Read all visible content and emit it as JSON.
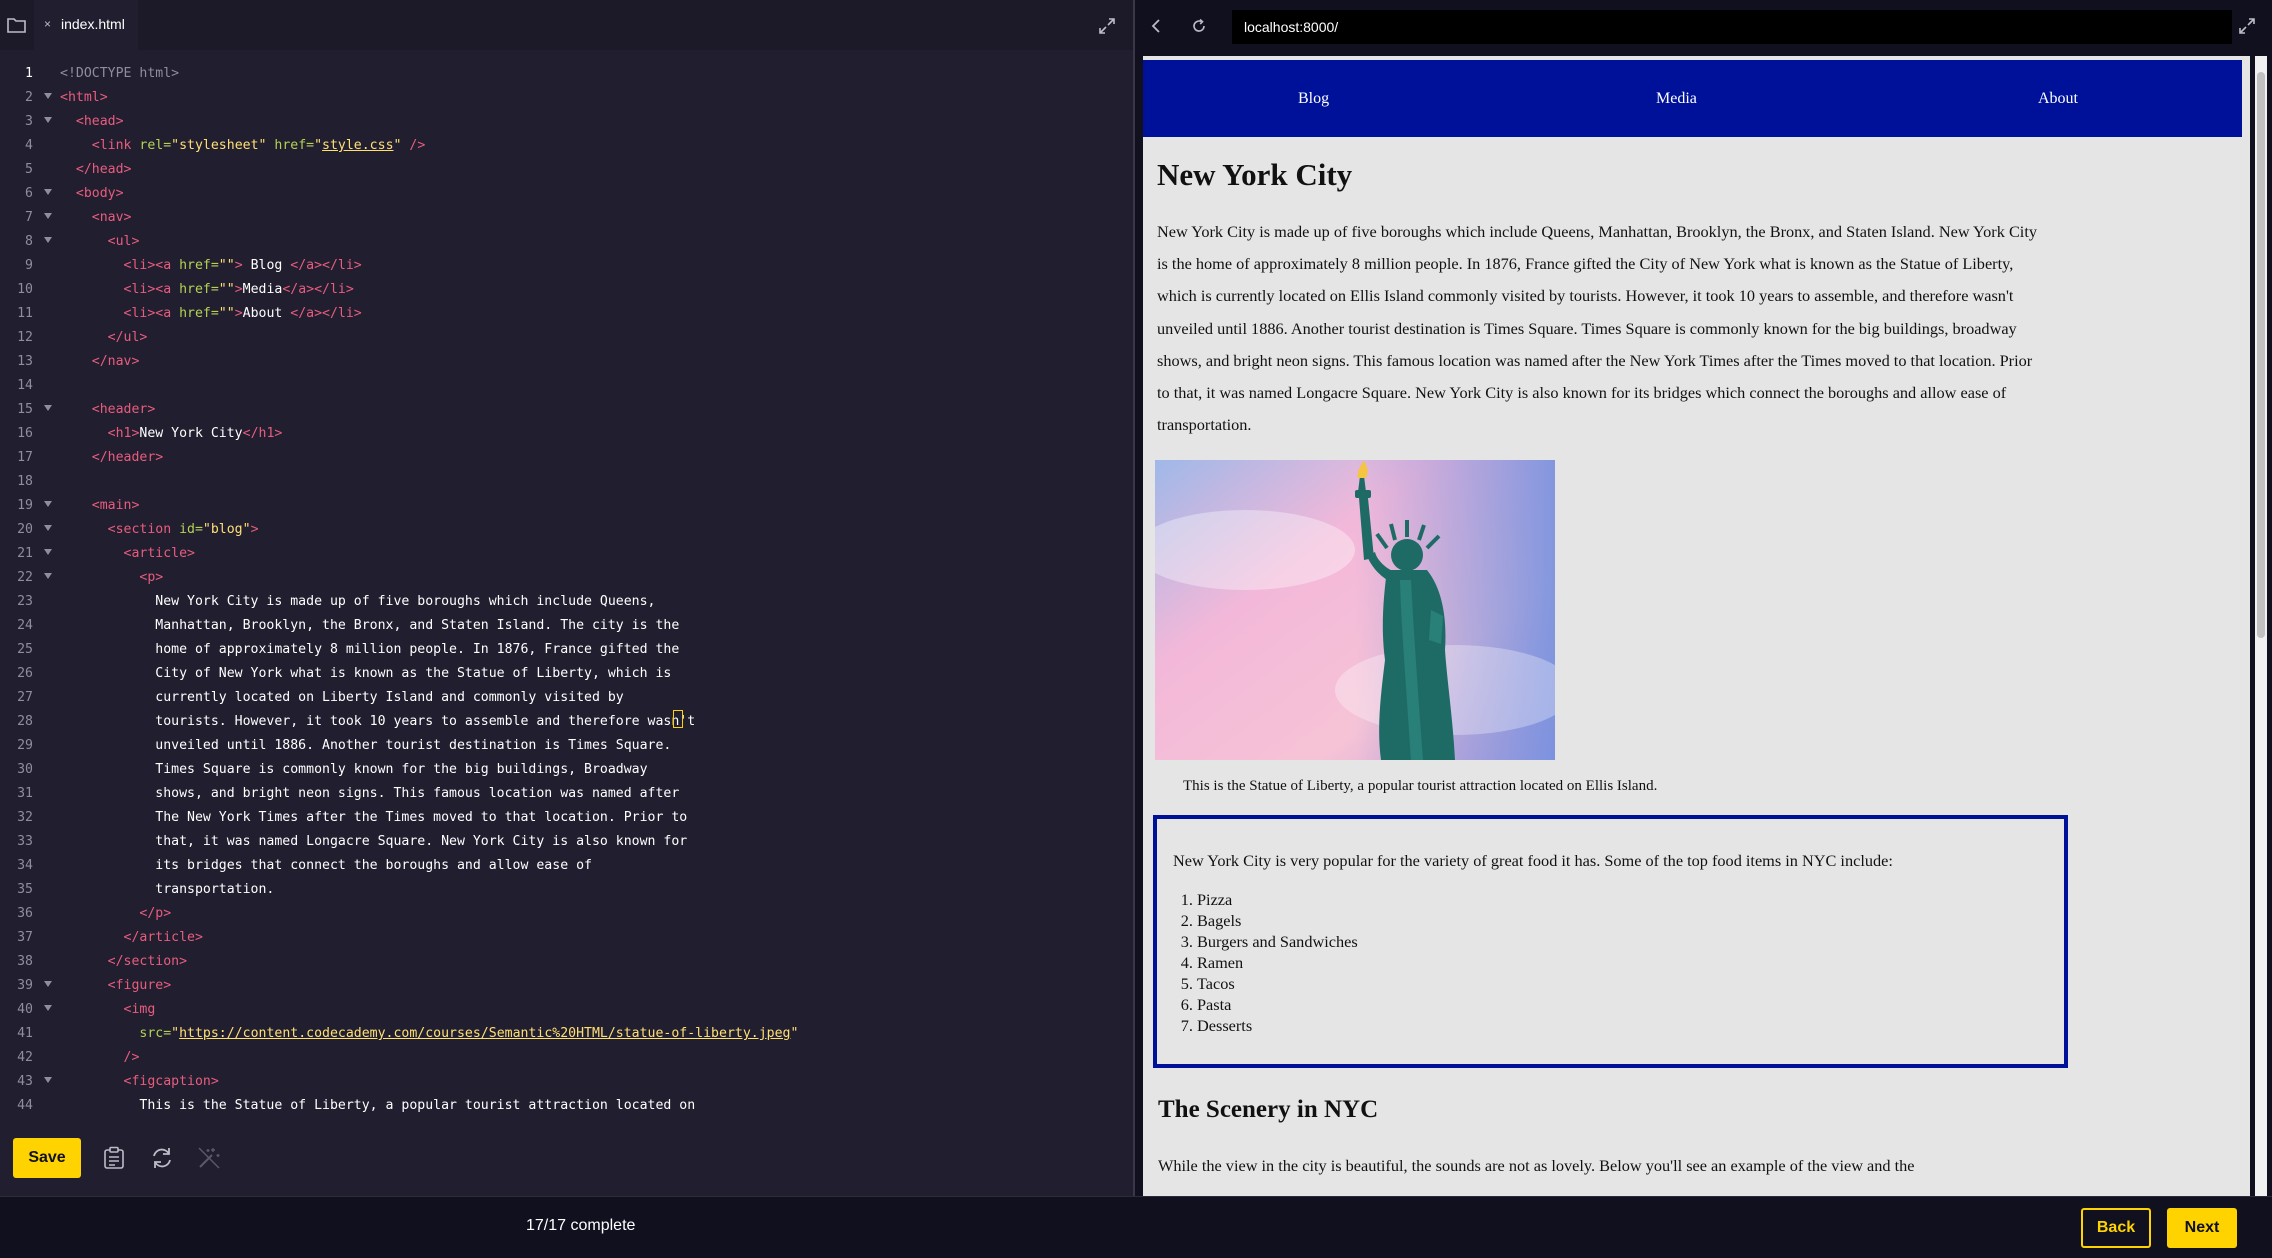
{
  "editor": {
    "tab": {
      "name": "index.html",
      "close_glyph": "×"
    },
    "code_lines": [
      [
        [
          "c",
          "<!DOCTYPE html>"
        ]
      ],
      [
        [
          "t",
          "<html>"
        ]
      ],
      [
        [
          "t",
          "  <head>"
        ]
      ],
      [
        [
          "t",
          "    <link "
        ],
        [
          "a",
          "rel="
        ],
        [
          "s",
          "\"stylesheet\""
        ],
        [
          "a",
          " href="
        ],
        [
          "s",
          "\""
        ],
        [
          "u",
          "style.css"
        ],
        [
          "s",
          "\""
        ],
        [
          "t",
          " />"
        ]
      ],
      [
        [
          "t",
          "  </head>"
        ]
      ],
      [
        [
          "t",
          "  <body>"
        ]
      ],
      [
        [
          "t",
          "    <nav>"
        ]
      ],
      [
        [
          "t",
          "      <ul>"
        ]
      ],
      [
        [
          "t",
          "        <li><a "
        ],
        [
          "a",
          "href="
        ],
        [
          "s",
          "\"\""
        ],
        [
          "t",
          ">"
        ],
        [
          "x",
          " Blog "
        ],
        [
          "t",
          "</a></li>"
        ]
      ],
      [
        [
          "t",
          "        <li><a "
        ],
        [
          "a",
          "href="
        ],
        [
          "s",
          "\"\""
        ],
        [
          "t",
          ">"
        ],
        [
          "x",
          "Media"
        ],
        [
          "t",
          "</a></li>"
        ]
      ],
      [
        [
          "t",
          "        <li><a "
        ],
        [
          "a",
          "href="
        ],
        [
          "s",
          "\"\""
        ],
        [
          "t",
          ">"
        ],
        [
          "x",
          "About "
        ],
        [
          "t",
          "</a></li>"
        ]
      ],
      [
        [
          "t",
          "      </ul>"
        ]
      ],
      [
        [
          "t",
          "    </nav>"
        ]
      ],
      [],
      [
        [
          "t",
          "    <header>"
        ]
      ],
      [
        [
          "t",
          "      <h1>"
        ],
        [
          "x",
          "New York City"
        ],
        [
          "t",
          "</h1>"
        ]
      ],
      [
        [
          "t",
          "    </header>"
        ]
      ],
      [],
      [
        [
          "t",
          "    <main>"
        ]
      ],
      [
        [
          "t",
          "      <section "
        ],
        [
          "a",
          "id="
        ],
        [
          "s",
          "\"blog\""
        ],
        [
          "t",
          ">"
        ]
      ],
      [
        [
          "t",
          "        <article>"
        ]
      ],
      [
        [
          "t",
          "          <p>"
        ]
      ],
      [
        [
          "x",
          "            New York City is made up of five boroughs which include Queens,"
        ]
      ],
      [
        [
          "x",
          "            Manhattan, Brooklyn, the Bronx, and Staten Island. The city is the"
        ]
      ],
      [
        [
          "x",
          "            home of approximately 8 million people. In 1876, France gifted the"
        ]
      ],
      [
        [
          "x",
          "            City of New York what is known as the Statue of Liberty, which is"
        ]
      ],
      [
        [
          "x",
          "            currently located on Liberty Island and commonly visited by"
        ]
      ],
      [
        [
          "x",
          "            tourists. However, it took 10 years to assemble and therefore wasn't"
        ]
      ],
      [
        [
          "x",
          "            unveiled until 1886. Another tourist destination is Times Square."
        ]
      ],
      [
        [
          "x",
          "            Times Square is commonly known for the big buildings, Broadway"
        ]
      ],
      [
        [
          "x",
          "            shows, and bright neon signs. This famous location was named after"
        ]
      ],
      [
        [
          "x",
          "            The New York Times after the Times moved to that location. Prior to"
        ]
      ],
      [
        [
          "x",
          "            that, it was named Longacre Square. New York City is also known for"
        ]
      ],
      [
        [
          "x",
          "            its bridges that connect the boroughs and allow ease of"
        ]
      ],
      [
        [
          "x",
          "            transportation."
        ]
      ],
      [
        [
          "t",
          "          </p>"
        ]
      ],
      [
        [
          "t",
          "        </article>"
        ]
      ],
      [
        [
          "t",
          "      </section>"
        ]
      ],
      [
        [
          "t",
          "      <figure>"
        ]
      ],
      [
        [
          "t",
          "        <img"
        ]
      ],
      [
        [
          "a",
          "          src="
        ],
        [
          "s",
          "\""
        ],
        [
          "u",
          "https://content.codecademy.com/courses/Semantic%20HTML/statue-of-liberty.jpeg"
        ],
        [
          "s",
          "\""
        ]
      ],
      [
        [
          "t",
          "        />"
        ]
      ],
      [
        [
          "t",
          "        <figcaption>"
        ]
      ],
      [
        [
          "x",
          "          This is the Statue of Liberty, a popular tourist attraction located on"
        ]
      ]
    ],
    "fold_lines": [
      2,
      3,
      6,
      7,
      8,
      15,
      19,
      20,
      21,
      22,
      39,
      40,
      43
    ],
    "current_line": 1,
    "caret_line": 28,
    "save_label": "Save",
    "toolbar_icons": [
      "clipboard-icon",
      "refresh-icon",
      "magic-wand-icon"
    ]
  },
  "progress": {
    "text": "17/17 complete"
  },
  "nav_buttons": {
    "back": "Back",
    "next": "Next"
  },
  "browser": {
    "url": "localhost:8000/",
    "page": {
      "nav": [
        "Blog",
        "Media",
        "About"
      ],
      "title": "New York City",
      "blog_paragraph": "New York City is made up of five boroughs which include Queens, Manhattan, Brooklyn, the Bronx, and Staten Island. New York City is the home of approximately 8 million people. In 1876, France gifted the City of New York what is known as the Statue of Liberty, which is currently located on Ellis Island commonly visited by tourists. However, it took 10 years to assemble, and therefore wasn't unveiled until 1886. Another tourist destination is Times Square. Times Square is commonly known for the big buildings, broadway shows, and bright neon signs. This famous location was named after the New York Times after the Times moved to that location. Prior to that, it was named Longacre Square. New York City is also known for its bridges which connect the boroughs and allow ease of transportation.",
      "figcaption": "This is the Statue of Liberty, a popular tourist attraction located on Ellis Island.",
      "food_intro": "New York City is very popular for the variety of great food it has. Some of the top food items in NYC include:",
      "food_items": [
        "Pizza",
        "Bagels",
        "Burgers and Sandwiches",
        "Ramen",
        "Tacos",
        "Pasta",
        "Desserts"
      ],
      "scenery_title": "The Scenery in NYC",
      "scenery_paragraph": "While the view in the city is beautiful, the sounds are not as lovely. Below you'll see an example of the view and the"
    }
  },
  "colors": {
    "accent": "#ffd300",
    "nav_blue": "#001199",
    "editor_bg": "#211e2f",
    "tag": "#e85d7d",
    "attr": "#b4d353",
    "string": "#ffe075"
  }
}
